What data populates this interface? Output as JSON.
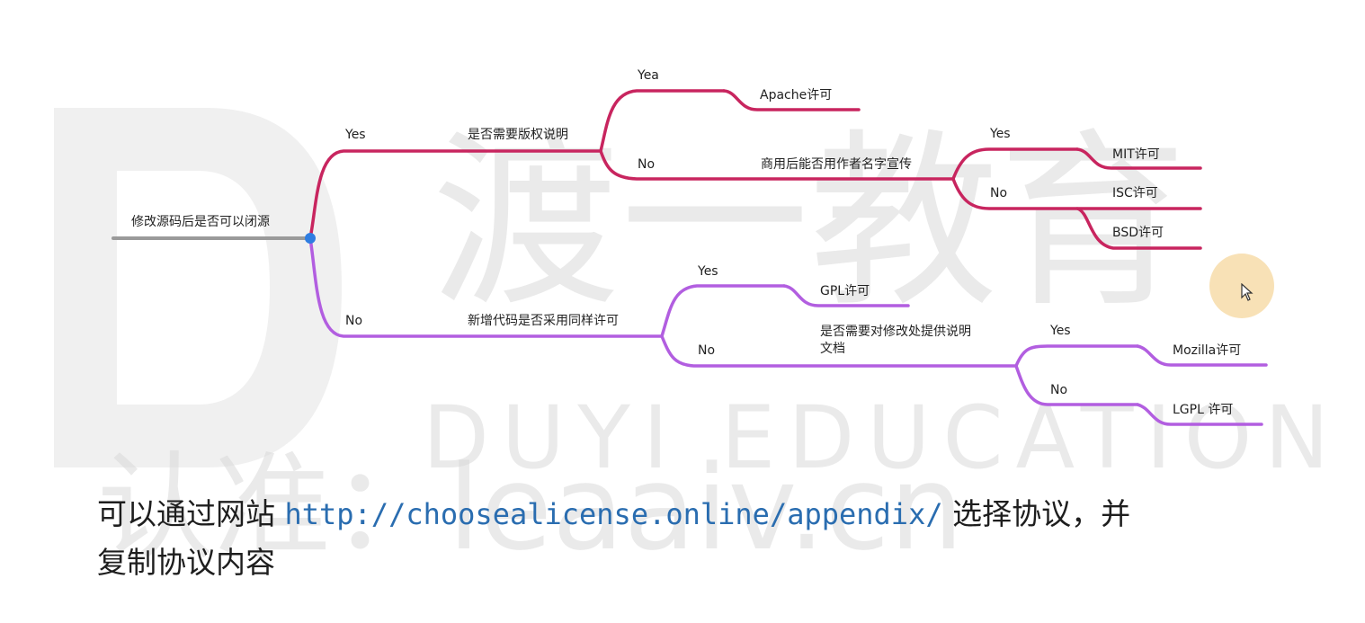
{
  "watermark": {
    "brand_letter": "D",
    "brand_cn": "渡一教育",
    "brand_en": "DUYI EDUCATION",
    "site": "认准：leaaiv.cn"
  },
  "diagram": {
    "colors": {
      "commercial_branch": "#c8255f",
      "copyleft_branch": "#b25ee0",
      "root_stub": "#9a9a9a",
      "root_dot": "#2f7de1"
    },
    "root": {
      "question": "修改源码后是否可以闭源"
    },
    "branch_yes": {
      "edge_label": "Yes",
      "question": "是否需要版权说明",
      "yea_label": "Yea",
      "yea_result": "Apache许可",
      "no_label": "No",
      "sub_question": "商用后能否用作者名字宣传",
      "sub_yes_label": "Yes",
      "sub_yes_result": "MIT许可",
      "sub_no_label": "No",
      "sub_no_result_1": "ISC许可",
      "sub_no_result_2": "BSD许可"
    },
    "branch_no": {
      "edge_label": "No",
      "question": "新增代码是否采用同样许可",
      "yes_label": "Yes",
      "yes_result": "GPL许可",
      "no_label": "No",
      "sub_question_line1": "是否需要对修改处提供说明",
      "sub_question_line2": "文档",
      "sub_yes_label": "Yes",
      "sub_yes_result": "Mozilla许可",
      "sub_no_label": "No",
      "sub_no_result": "LGPL 许可"
    }
  },
  "caption": {
    "prefix": "可以通过网站 ",
    "url": "http://choosealicense.online/appendix/",
    "suffix_line1": " 选择协议，并",
    "line2": "复制协议内容"
  }
}
